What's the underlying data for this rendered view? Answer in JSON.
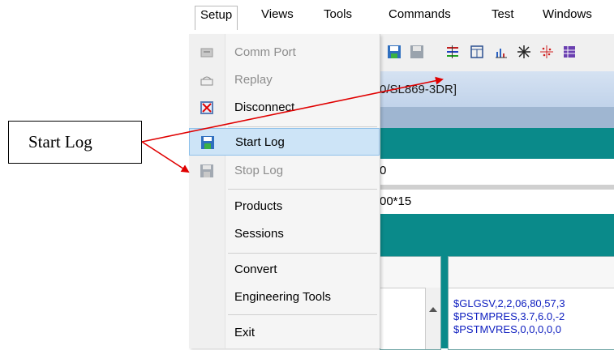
{
  "menubar": {
    "items": [
      "Setup",
      "Views",
      "Tools",
      "Commands",
      "Test",
      "Windows"
    ],
    "active": "Setup"
  },
  "dropdown": {
    "items": [
      {
        "label": "Comm Port",
        "enabled": false,
        "icon": "comm-port-icon"
      },
      {
        "label": "Replay",
        "enabled": false,
        "icon": "replay-icon"
      },
      {
        "label": "Disconnect",
        "enabled": true,
        "icon": "disconnect-icon"
      },
      {
        "label": "Start Log",
        "enabled": true,
        "icon": "start-log-icon",
        "highlighted": true
      },
      {
        "label": "Stop Log",
        "enabled": false,
        "icon": "stop-log-icon"
      },
      {
        "label": "Products",
        "enabled": true
      },
      {
        "label": "Sessions",
        "enabled": true
      },
      {
        "label": "Convert",
        "enabled": true
      },
      {
        "label": "Engineering Tools",
        "enabled": true
      },
      {
        "label": "Exit",
        "enabled": true
      }
    ]
  },
  "background": {
    "title_fragment": "0/SL869-3DR]",
    "field1_fragment": "0",
    "field2_fragment": "00*15",
    "nmea_lines": [
      "$GLGSV,2,2,06,80,57,3",
      "$PSTMPRES,3.7,6.0,-2",
      "$PSTMVRES,0,0,0,0,0"
    ]
  },
  "callout": {
    "text": "Start Log",
    "color": "#e00000"
  },
  "colors": {
    "highlight": "#cde4f7",
    "teal": "#0a8a8a",
    "nmea_text": "#1020c0"
  }
}
